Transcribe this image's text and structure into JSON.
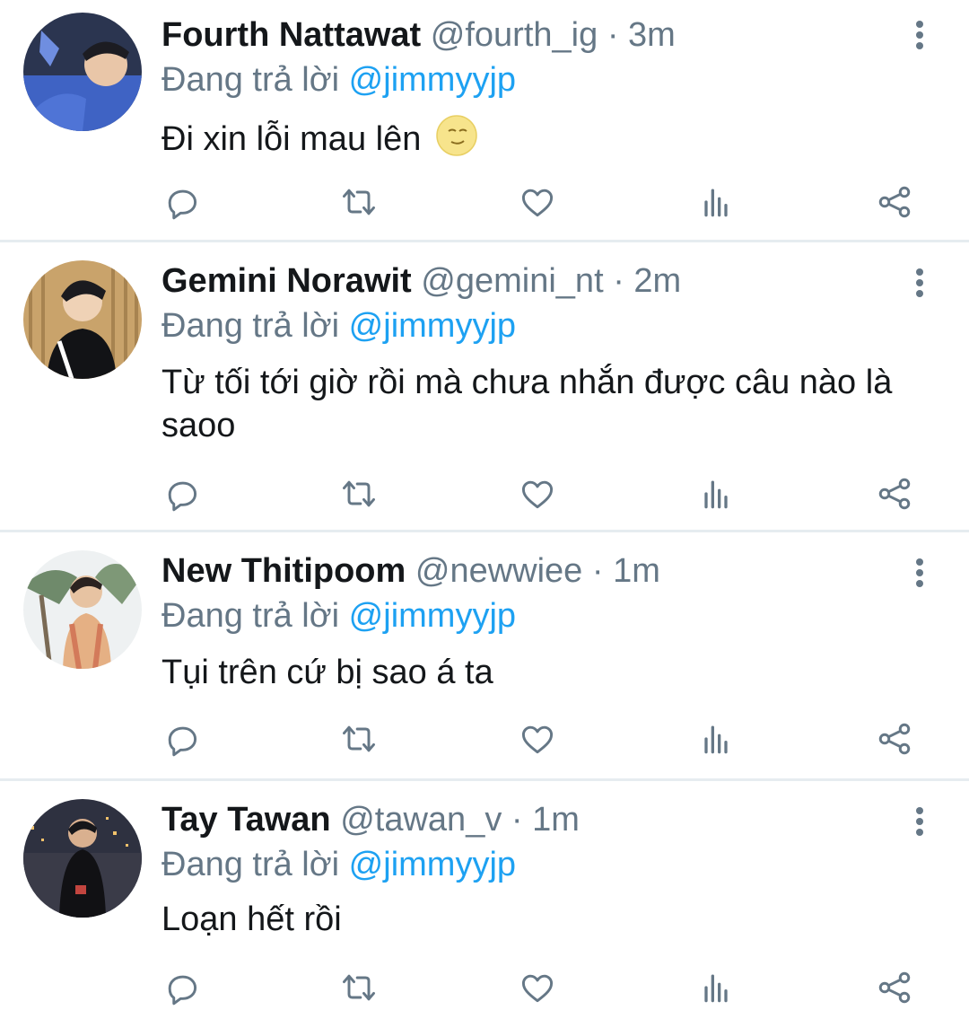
{
  "tweets": [
    {
      "name": "Fourth Nattawat",
      "handle": "@fourth_ig",
      "time": "3m",
      "replying_prefix": "Đang trả lời",
      "replying_to": "@jimmyyjp",
      "text": "Đi xin lỗi mau lên",
      "emoji": "moon-face-emoji",
      "avatar_color": "#3b5fb5"
    },
    {
      "name": "Gemini Norawit",
      "handle": "@gemini_nt",
      "time": "2m",
      "replying_prefix": "Đang trả lời",
      "replying_to": "@jimmyyjp",
      "text": "Từ tối tới giờ rồi mà chưa nhắn được câu nào là saoo",
      "avatar_color": "#b08d5a"
    },
    {
      "name": "New Thitipoom",
      "handle": "@newwiee",
      "time": "1m",
      "replying_prefix": "Đang trả lời",
      "replying_to": "@jimmyyjp",
      "text": "Tụi trên cứ bị sao á ta",
      "avatar_color": "#d9a77a"
    },
    {
      "name": "Tay Tawan",
      "handle": "@tawan_v",
      "time": "1m",
      "replying_prefix": "Đang trả lời",
      "replying_to": "@jimmyyjp",
      "text": "Loạn hết rồi",
      "avatar_color": "#2a2d3a"
    }
  ],
  "meta_separator": "·",
  "action_icons": [
    "reply-icon",
    "retweet-icon",
    "like-icon",
    "analytics-icon",
    "share-icon"
  ],
  "colors": {
    "accent": "#1da1f2",
    "secondary": "#657786",
    "divider": "#e6ecf0",
    "text": "#14171a"
  }
}
